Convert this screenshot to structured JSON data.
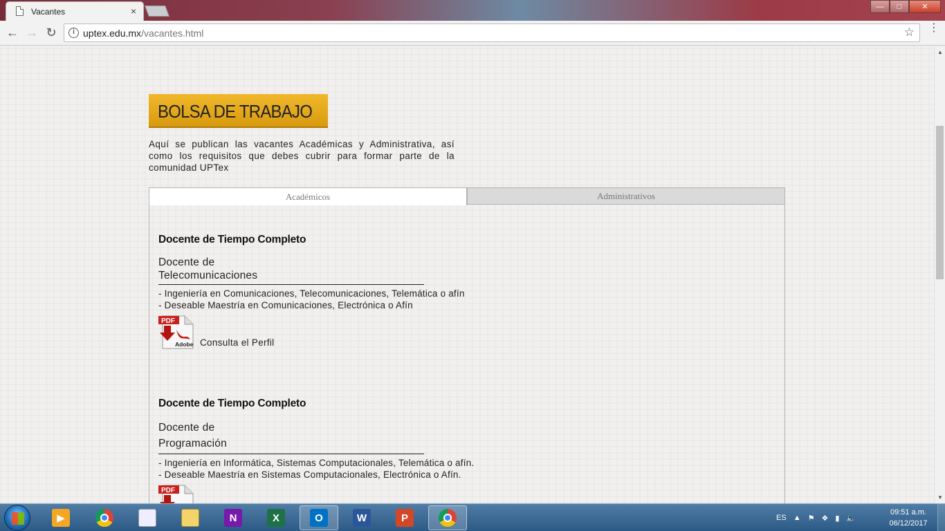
{
  "browser": {
    "tab_title": "Vacantes",
    "tab_close": "×",
    "url_domain": "uptex.edu.mx",
    "url_path": "/vacantes.html",
    "info_glyph": "i",
    "star_glyph": "☆",
    "back_glyph": "←",
    "forward_glyph": "→",
    "reload_glyph": "↻",
    "menu_glyph": "⋮"
  },
  "window_controls": {
    "minimize": "—",
    "maximize": "□",
    "close": "✕"
  },
  "page": {
    "banner": "BOLSA DE TRABAJO",
    "intro": "Aquí se publican las vacantes Académicas y Administrativa, así como los requisitos que debes cubrir para formar parte de la comunidad UPTex",
    "tabs": {
      "academic": "Académicos",
      "admin": "Administrativos"
    },
    "jobs": [
      {
        "type": "Docente de Tiempo Completo",
        "title_line1": "Docente de",
        "title_line2": "Telecomunicaciones",
        "req1": "- Ingeniería en Comunicaciones, Telecomunicaciones, Telemática o afín",
        "req2": "- Deseable Maestría en Comunicaciones, Electrónica o Afín",
        "link": "Consulta el Perfil"
      },
      {
        "type": "Docente de Tiempo Completo",
        "title_line1": "Docente de",
        "title_line2": "Programación",
        "req1": "- Ingeniería en Informática, Sistemas Computacionales, Telemática o afín.",
        "req2": "- Deseable Maestría en Sistemas Computacionales, Electrónica o Afín.",
        "link": ""
      }
    ],
    "pdf_label": "PDF",
    "adobe_label": "Adobe"
  },
  "taskbar": {
    "apps": [
      "media-player",
      "chrome",
      "notepad",
      "file-explorer",
      "onenote",
      "excel",
      "outlook",
      "word",
      "powerpoint",
      "chrome"
    ],
    "onenote_glyph": "N",
    "excel_glyph": "X",
    "outlook_glyph": "O",
    "word_glyph": "W",
    "powerpoint_glyph": "P",
    "language": "ES",
    "time": "09:51 a.m.",
    "date": "06/12/2017"
  }
}
